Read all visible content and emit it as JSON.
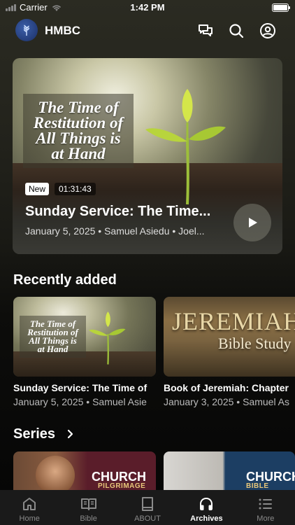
{
  "status_bar": {
    "carrier": "Carrier",
    "time": "1:42 PM"
  },
  "header": {
    "title": "HMBC",
    "icons": [
      "chat-icon",
      "search-icon",
      "account-icon"
    ]
  },
  "featured": {
    "artwork_text": "The Time of\nRestitution of\nAll Things is\nat Hand",
    "badge": "New",
    "duration": "01:31:43",
    "title": "Sunday Service: The Time...",
    "meta": "January 5, 2025 • Samuel Asiedu   • Joel..."
  },
  "recently_added": {
    "heading": "Recently added",
    "items": [
      {
        "artwork_text": "The Time of\nRestitution of\nAll Things is\nat Hand",
        "title": "Sunday Service: The Time of",
        "meta": "January 5, 2025 • Samuel Asie"
      },
      {
        "artwork_title": "JEREMIAH",
        "artwork_subtitle": "Bible Study",
        "title": "Book of Jeremiah: Chapter",
        "meta": "January 3, 2025 • Samuel As"
      }
    ]
  },
  "series": {
    "heading": "Series",
    "items": [
      {
        "label": "CHURCH",
        "sublabel": "PILGRIMAGE"
      },
      {
        "label": "CHURCH",
        "sublabel": "BIBLE STUDY"
      }
    ]
  },
  "tab_bar": {
    "tabs": [
      {
        "label": "Home",
        "icon": "home-icon",
        "active": false
      },
      {
        "label": "Bible",
        "icon": "bible-icon",
        "active": false
      },
      {
        "label": "ABOUT",
        "icon": "book-icon",
        "active": false
      },
      {
        "label": "Archives",
        "icon": "headphones-icon",
        "active": true
      },
      {
        "label": "More",
        "icon": "menu-icon",
        "active": false
      }
    ]
  },
  "colors": {
    "accent_active_tab": "#ffffff",
    "inactive_tab": "#8a8a8a",
    "tab_bar_bg": "#1a1a1a"
  }
}
